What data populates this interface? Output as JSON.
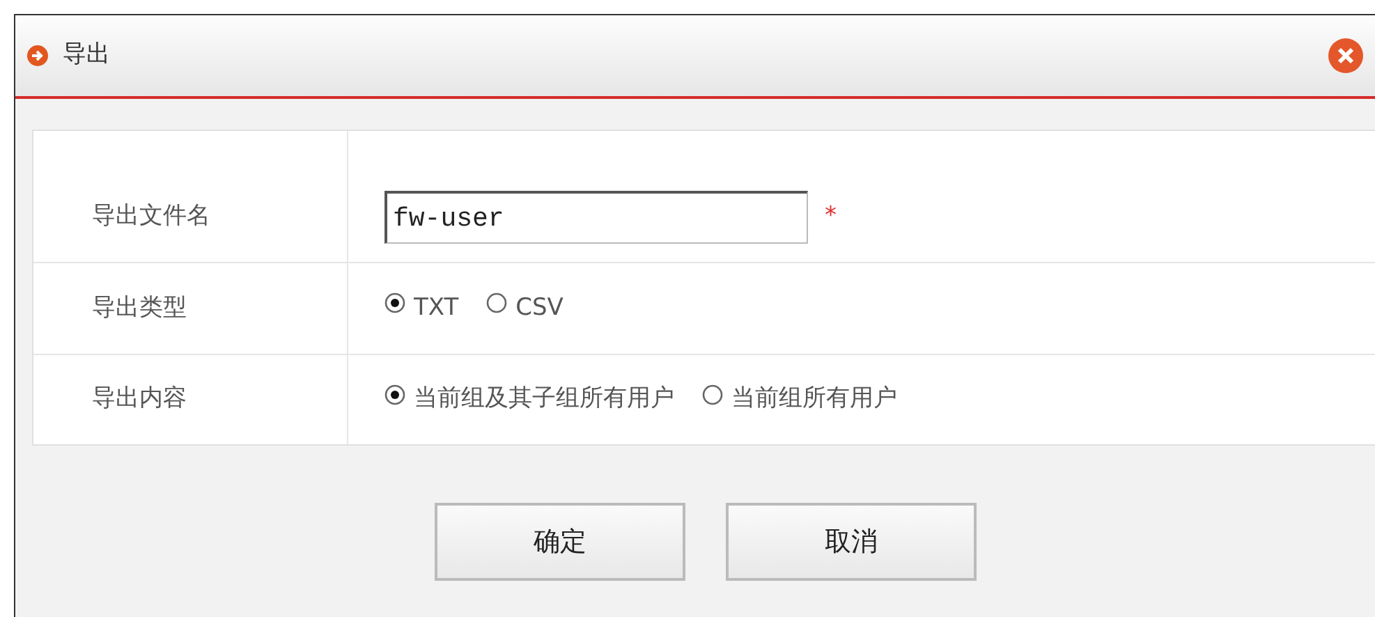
{
  "window": {
    "title": "导出"
  },
  "form": {
    "rows": [
      {
        "kind": "text",
        "label": "导出文件名",
        "value": "fw-user",
        "required_mark": "*"
      },
      {
        "kind": "radio",
        "label": "导出类型",
        "options": [
          {
            "label": "TXT",
            "selected": true
          },
          {
            "label": "CSV",
            "selected": false
          }
        ]
      },
      {
        "kind": "radio",
        "label": "导出内容",
        "options": [
          {
            "label": "当前组及其子组所有用户",
            "selected": true
          },
          {
            "label": "当前组所有用户",
            "selected": false
          }
        ]
      }
    ]
  },
  "buttons": [
    "确定",
    "取消"
  ]
}
